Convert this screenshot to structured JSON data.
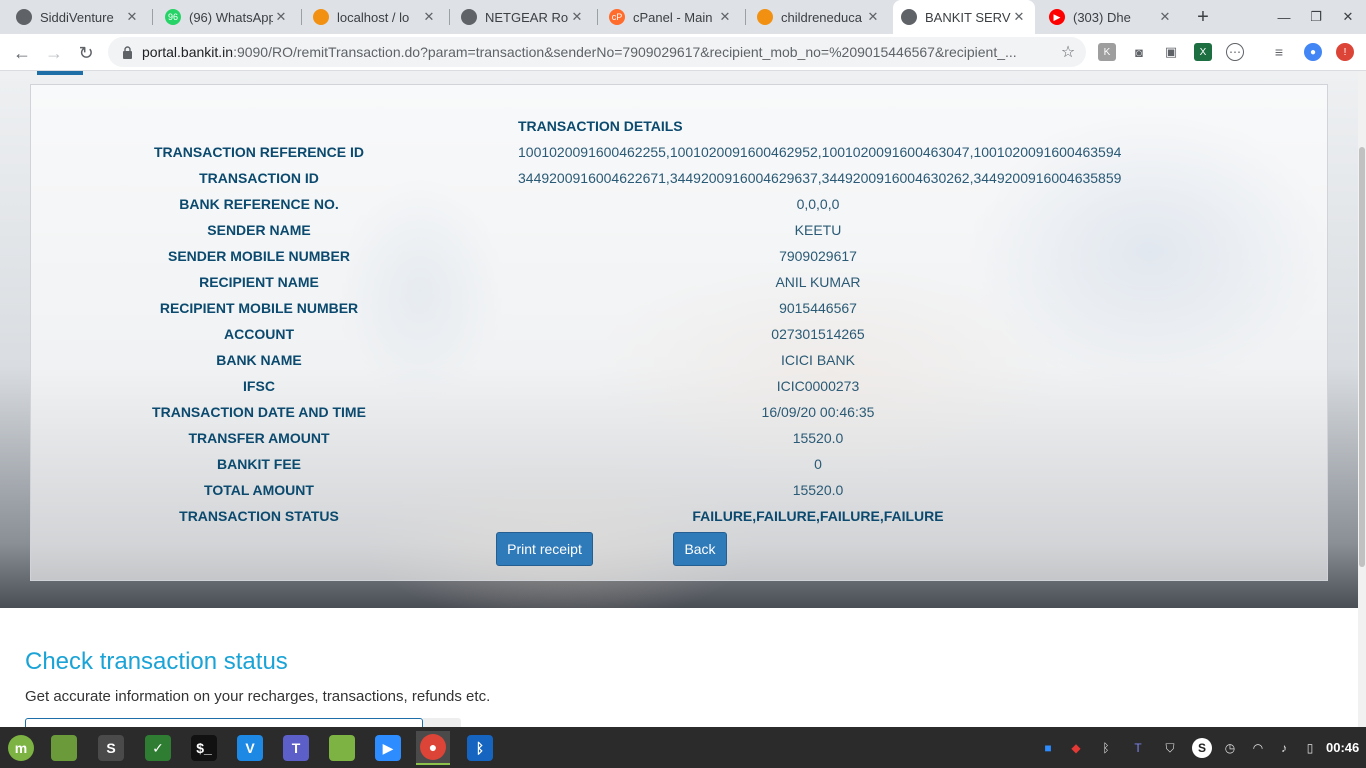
{
  "browser": {
    "tabs": [
      {
        "title": "SiddiVenture",
        "fav_color": "#5f6368",
        "fav_glyph": ""
      },
      {
        "title": "(96) WhatsApp",
        "fav_color": "#25d366",
        "fav_glyph": "96"
      },
      {
        "title": "localhost / lo",
        "fav_color": "#f29111",
        "fav_glyph": ""
      },
      {
        "title": "NETGEAR Rou",
        "fav_color": "#5f6368",
        "fav_glyph": ""
      },
      {
        "title": "cPanel - Main",
        "fav_color": "#ff6c2c",
        "fav_glyph": "cP"
      },
      {
        "title": "childreneduca",
        "fav_color": "#f29111",
        "fav_glyph": ""
      },
      {
        "title": "BANKIT SERVI",
        "fav_color": "#5f6368",
        "fav_glyph": ""
      },
      {
        "title": "(303) Dhe",
        "fav_color": "#ff0000",
        "fav_glyph": "▶"
      }
    ],
    "active_tab": 6,
    "url_host": "portal.bankit.in",
    "url_rest": ":9090/RO/remitTransaction.do?param=transaction&senderNo=7909029617&recipient_mob_no=%209015446567&recipient_..."
  },
  "transaction": {
    "title": "TRANSACTION DETAILS",
    "rows": [
      {
        "label": "TRANSACTION REFERENCE ID",
        "value": "1001020091600462255,1001020091600462952,1001020091600463047,1001020091600463594"
      },
      {
        "label": "TRANSACTION ID",
        "value": "3449200916004622671,3449200916004629637,3449200916004630262,3449200916004635859"
      },
      {
        "label": "BANK REFERENCE NO.",
        "value": "0,0,0,0"
      },
      {
        "label": "SENDER NAME",
        "value": "KEETU"
      },
      {
        "label": "SENDER MOBILE NUMBER",
        "value": "7909029617"
      },
      {
        "label": "RECIPIENT NAME",
        "value": "ANIL KUMAR"
      },
      {
        "label": "RECIPIENT MOBILE NUMBER",
        "value": "9015446567"
      },
      {
        "label": "ACCOUNT",
        "value": "027301514265"
      },
      {
        "label": "BANK NAME",
        "value": "ICICI BANK"
      },
      {
        "label": "IFSC",
        "value": "ICIC0000273"
      },
      {
        "label": "TRANSACTION DATE AND TIME",
        "value": "16/09/20 00:46:35"
      },
      {
        "label": "TRANSFER AMOUNT",
        "value": "15520.0"
      },
      {
        "label": "BANKIT FEE",
        "value": "0"
      },
      {
        "label": "TOTAL AMOUNT",
        "value": "15520.0"
      },
      {
        "label": "TRANSACTION STATUS",
        "value": "FAILURE,FAILURE,FAILURE,FAILURE"
      }
    ],
    "print_label": "Print receipt",
    "back_label": "Back"
  },
  "check": {
    "title": "Check transaction status",
    "subtitle": "Get accurate information on your recharges, transactions, refunds etc."
  },
  "taskbar": {
    "clock": "00:46",
    "apps": [
      {
        "name": "mint-menu",
        "color": "#7cb342",
        "glyph": "m"
      },
      {
        "name": "files",
        "color": "#6a9a3a",
        "glyph": ""
      },
      {
        "name": "sublime",
        "color": "#4a4a4a",
        "glyph": "S"
      },
      {
        "name": "shield",
        "color": "#2e7d32",
        "glyph": "✓"
      },
      {
        "name": "terminal",
        "color": "#111111",
        "glyph": "$_"
      },
      {
        "name": "vscode",
        "color": "#1e88e5",
        "glyph": "V"
      },
      {
        "name": "teams",
        "color": "#5b5fc7",
        "glyph": "T"
      },
      {
        "name": "folder",
        "color": "#7cb342",
        "glyph": ""
      },
      {
        "name": "zoom",
        "color": "#2d8cff",
        "glyph": "▶"
      },
      {
        "name": "chrome",
        "color": "#db4437",
        "glyph": "●"
      },
      {
        "name": "bluetooth",
        "color": "#1565c0",
        "glyph": "ᛒ"
      }
    ]
  }
}
